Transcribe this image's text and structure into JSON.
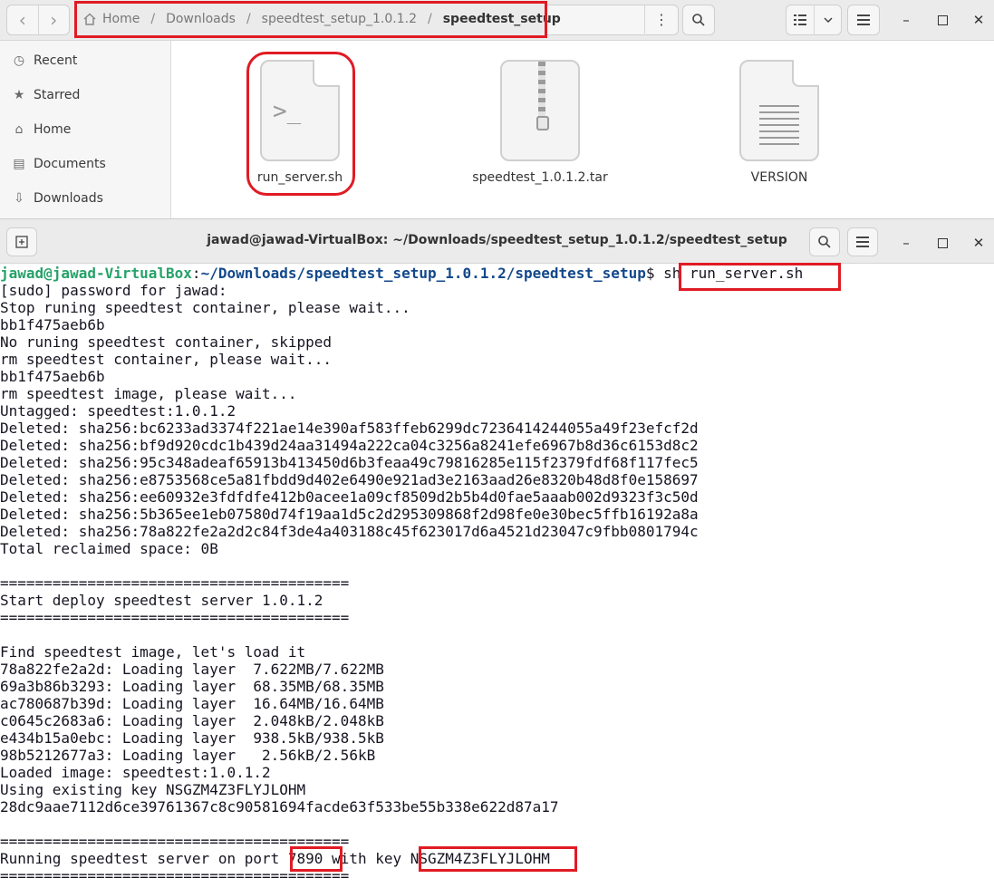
{
  "file_manager": {
    "breadcrumb": [
      "Home",
      "Downloads",
      "speedtest_setup_1.0.1.2",
      "speedtest_setup"
    ],
    "sidebar": [
      {
        "label": "Recent",
        "icon": "clock-icon"
      },
      {
        "label": "Starred",
        "icon": "star-icon"
      },
      {
        "label": "Home",
        "icon": "home-icon"
      },
      {
        "label": "Documents",
        "icon": "document-icon"
      },
      {
        "label": "Downloads",
        "icon": "download-icon"
      }
    ],
    "files": [
      {
        "name": "run_server.sh",
        "icon": "script-file-icon"
      },
      {
        "name": "speedtest_1.0.1.2.tar",
        "icon": "archive-file-icon"
      },
      {
        "name": "VERSION",
        "icon": "text-file-icon"
      }
    ]
  },
  "terminal": {
    "title": "jawad@jawad-VirtualBox: ~/Downloads/speedtest_setup_1.0.1.2/speedtest_setup",
    "prompt_user": "jawad@jawad-VirtualBox",
    "prompt_sep": ":",
    "prompt_path": "~/Downloads/speedtest_setup_1.0.1.2/speedtest_setup",
    "prompt_dollar": "$",
    "command": " sh run_server.sh",
    "output": [
      "[sudo] password for jawad:",
      "Stop runing speedtest container, please wait...",
      "bb1f475aeb6b",
      "No runing speedtest container, skipped",
      "rm speedtest container, please wait...",
      "bb1f475aeb6b",
      "rm speedtest image, please wait...",
      "Untagged: speedtest:1.0.1.2",
      "Deleted: sha256:bc6233ad3374f221ae14e390af583ffeb6299dc7236414244055a49f23efcf2d",
      "Deleted: sha256:bf9d920cdc1b439d24aa31494a222ca04c3256a8241efe6967b8d36c6153d8c2",
      "Deleted: sha256:95c348adeaf65913b413450d6b3feaa49c79816285e115f2379fdf68f117fec5",
      "Deleted: sha256:e8753568ce5a81fbdd9d402e6490e921ad3e2163aad26e8320b48d8f0e158697",
      "Deleted: sha256:ee60932e3fdfdfe412b0acee1a09cf8509d2b5b4d0fae5aaab002d9323f3c50d",
      "Deleted: sha256:5b365ee1eb07580d74f19aa1d5c2d295309868f2d98fe0e30bec5ffb16192a8a",
      "Deleted: sha256:78a822fe2a2d2c84f3de4a403188c45f623017d6a4521d23047c9fbb0801794c",
      "Total reclaimed space: 0B",
      "",
      "========================================",
      "Start deploy speedtest server 1.0.1.2",
      "========================================",
      "",
      "Find speedtest image, let's load it",
      "78a822fe2a2d: Loading layer  7.622MB/7.622MB",
      "69a3b86b3293: Loading layer  68.35MB/68.35MB",
      "ac780687b39d: Loading layer  16.64MB/16.64MB",
      "c0645c2683a6: Loading layer  2.048kB/2.048kB",
      "e434b15a0ebc: Loading layer  938.5kB/938.5kB",
      "98b5212677a3: Loading layer   2.56kB/2.56kB",
      "Loaded image: speedtest:1.0.1.2",
      "Using existing key NSGZM4Z3FLYJLOHM",
      "28dc9aae7112d6ce39761367c8c90581694facde63f533be55b338e622d87a17",
      "",
      "========================================",
      "Running speedtest server on port 7890 with key NSGZM4Z3FLYJLOHM",
      "========================================"
    ]
  }
}
